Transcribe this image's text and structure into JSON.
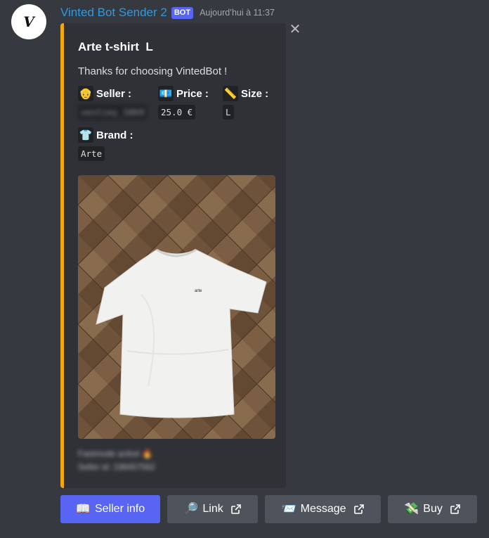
{
  "avatar": {
    "letter": "V"
  },
  "header": {
    "username": "Vinted Bot Sender 2",
    "bot_tag": "BOT",
    "timestamp": "Aujourd’hui à 11:37"
  },
  "embed": {
    "accent_color": "#f1a80f",
    "title": "Arte t-shirt  L",
    "description": "Thanks for choosing VintedBot !",
    "fields": {
      "seller": {
        "emoji": "👴",
        "name": "Seller :",
        "value": "vestiey_5069"
      },
      "price": {
        "emoji": "💶",
        "name": "Price :",
        "value": "25.0 €"
      },
      "size": {
        "emoji": "📏",
        "name": "Size :",
        "value": "L"
      },
      "brand": {
        "emoji": "👕",
        "name": "Brand :",
        "value": "Arte"
      }
    },
    "footer": {
      "line1": "Fastmode activé 🔥",
      "line2": "Seller id: 198457562"
    }
  },
  "buttons": {
    "seller_info": {
      "emoji": "📖",
      "label": "Seller info"
    },
    "link": {
      "emoji": "🔎",
      "label": "Link"
    },
    "message": {
      "emoji": "📨",
      "label": "Message"
    },
    "buy": {
      "emoji": "💸",
      "label": "Buy"
    }
  },
  "icons": {
    "close": "close-icon",
    "external_link": "external-link-icon"
  }
}
